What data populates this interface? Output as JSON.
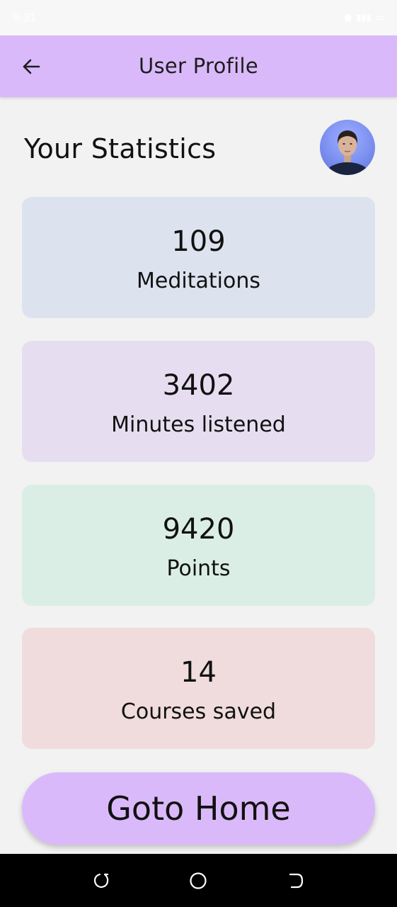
{
  "status_bar": {
    "time": "9:31",
    "icons": [
      "alarm-icon",
      "signal-icon",
      "battery-icon"
    ]
  },
  "app_bar": {
    "title": "User Profile",
    "back_icon": "arrow-left-icon"
  },
  "stats": {
    "heading": "Your Statistics",
    "cards": [
      {
        "value": "109",
        "label": "Meditations",
        "color": "#dce3ef"
      },
      {
        "value": "3402",
        "label": "Minutes listened",
        "color": "#e6def0"
      },
      {
        "value": "9420",
        "label": "Points",
        "color": "#dbeee5"
      },
      {
        "value": "14",
        "label": "Courses saved",
        "color": "#f0dcdd"
      }
    ]
  },
  "home_button": {
    "label": "Goto Home"
  },
  "colors": {
    "accent": "#dab9fa",
    "background": "#f2f2f2"
  },
  "nav": [
    "recent-apps-icon",
    "home-circle-icon",
    "back-icon"
  ]
}
